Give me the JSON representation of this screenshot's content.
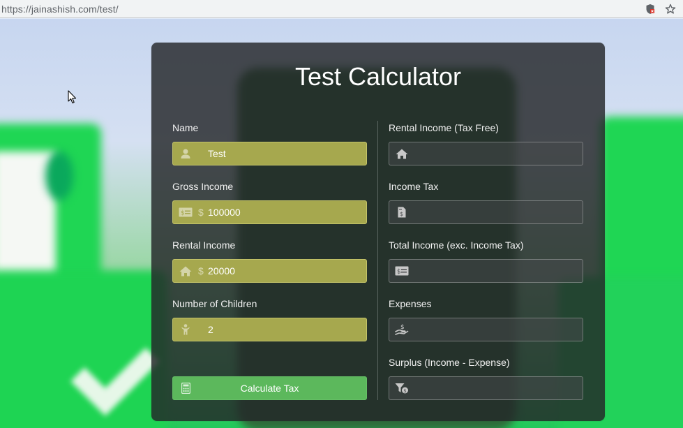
{
  "browser": {
    "url": "https://jainashish.com/test/",
    "icons": [
      "shield-icon",
      "bookmark-star-icon"
    ]
  },
  "calculator": {
    "title": "Test Calculator",
    "left_fields": [
      {
        "label": "Name",
        "icon": "user-icon",
        "prefix": "",
        "value": "Test"
      },
      {
        "label": "Gross Income",
        "icon": "money-bill-icon",
        "prefix": "$",
        "value": "100000"
      },
      {
        "label": "Rental Income",
        "icon": "home-icon",
        "prefix": "$",
        "value": "20000"
      },
      {
        "label": "Number of Children",
        "icon": "child-icon",
        "prefix": "",
        "value": "2"
      }
    ],
    "right_fields": [
      {
        "label": "Rental Income (Tax Free)",
        "icon": "home-icon",
        "value": ""
      },
      {
        "label": "Income Tax",
        "icon": "invoice-dollar-icon",
        "value": ""
      },
      {
        "label": "Total Income (exc. Income Tax)",
        "icon": "money-bill-icon",
        "value": ""
      },
      {
        "label": "Expenses",
        "icon": "hand-holding-dollar-icon",
        "value": ""
      },
      {
        "label": "Surplus (Income - Expense)",
        "icon": "filter-dollar-icon",
        "value": ""
      }
    ],
    "calculate_button": {
      "label": "Calculate Tax",
      "icon": "calculator-icon"
    }
  },
  "colors": {
    "panel": "#232628",
    "filled_input": "#a6a84e",
    "button": "#5cb85c",
    "accent_green": "#22c95a"
  }
}
